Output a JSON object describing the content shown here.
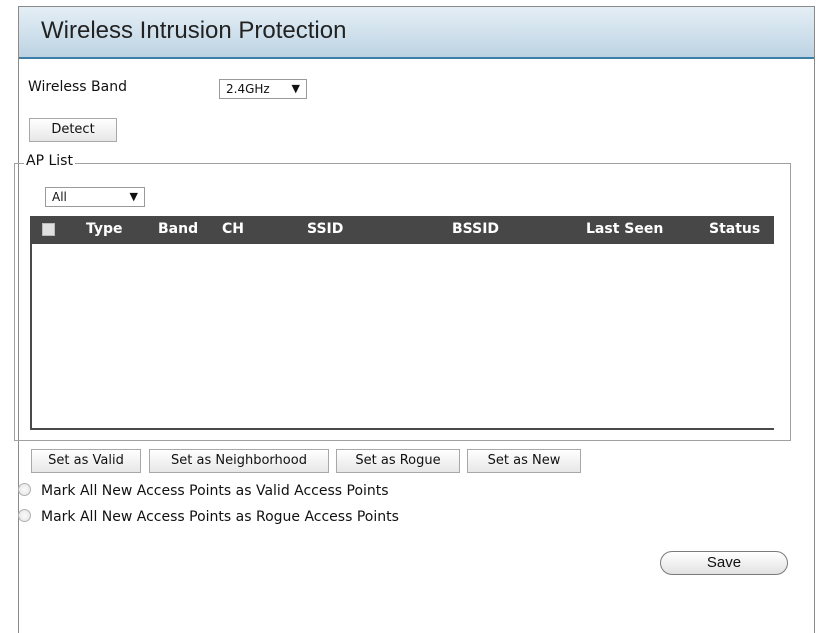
{
  "header": {
    "title": "Wireless Intrusion Protection"
  },
  "band": {
    "label": "Wireless Band",
    "selected": "2.4GHz"
  },
  "detect_label": "Detect",
  "ap_list": {
    "legend": "AP List",
    "filter_selected": "All",
    "columns": [
      "Type",
      "Band",
      "CH",
      "SSID",
      "BSSID",
      "Last Seen",
      "Status"
    ],
    "rows": []
  },
  "actions": {
    "valid": "Set as Valid",
    "neighborhood": "Set as Neighborhood",
    "rogue": "Set as Rogue",
    "new": "Set as New"
  },
  "options": {
    "mark_valid": "Mark All New Access Points as Valid Access Points",
    "mark_rogue": "Mark All New Access Points as Rogue Access Points"
  },
  "save_label": "Save"
}
